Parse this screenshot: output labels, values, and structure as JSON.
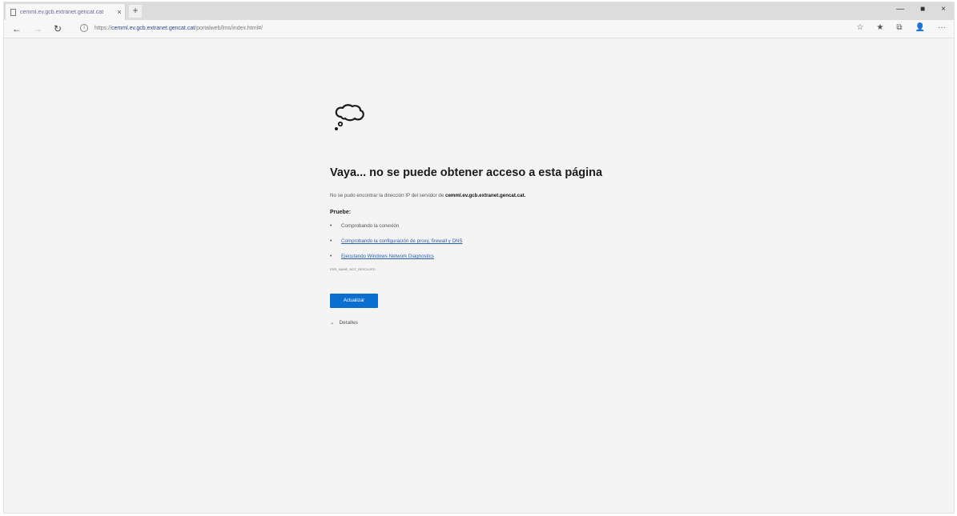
{
  "browser": {
    "tab_title": "cemml.ev.gcb.extranet.gencat.cat",
    "tab_close": "×",
    "new_tab": "+",
    "window_controls": [
      "—",
      "■",
      "×"
    ],
    "nav": {
      "back": "←",
      "forward": "→",
      "refresh": "↻"
    },
    "url_protocol": "https://",
    "url_host": "cemml.ev.gcb.extranet.gencat.cat",
    "url_path": "/portalweb/lms/index.html#/",
    "toolbar_icons": [
      "☆",
      "★",
      "⧉",
      "👤",
      "···"
    ]
  },
  "error": {
    "icon": "cloud-thought-icon",
    "headline": "Vaya... no se puede obtener acceso a esta página",
    "desc_prefix": "No se pudo encontrar la dirección IP del servidor de ",
    "desc_host": "cemml.ev.gcb.extranet.gencat.cat.",
    "try_title": "Pruebe:",
    "suggestions": [
      "Comprobando la conexión",
      "Comprobando la configuración de proxy, firewall y DNS",
      "Ejecutando Windows Network Diagnostics"
    ],
    "error_code": "ERR_NAME_NOT_RESOLVED",
    "refresh_label": "Actualizar",
    "details_label": "Detalles",
    "details_chevron": "⌄"
  }
}
